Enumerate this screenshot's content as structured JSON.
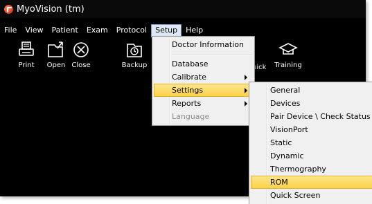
{
  "window": {
    "title": "MyoVision (tm)",
    "app_icon": "myovision-logo-icon"
  },
  "menubar": {
    "items": [
      {
        "label": "File"
      },
      {
        "label": "View"
      },
      {
        "label": "Patient"
      },
      {
        "label": "Exam"
      },
      {
        "label": "Protocol"
      },
      {
        "label": "Setup",
        "active": true
      },
      {
        "label": "Help"
      }
    ]
  },
  "toolbar": {
    "buttons": [
      {
        "label": "Print",
        "icon": "printer-icon"
      },
      {
        "label": "Open",
        "icon": "open-folder-icon"
      },
      {
        "label": "Close",
        "icon": "close-circle-icon"
      },
      {
        "label": "Backup",
        "icon": "backup-clock-icon"
      },
      {
        "label": "uick",
        "icon": ""
      },
      {
        "label": "Training",
        "icon": "graduation-cap-icon"
      }
    ]
  },
  "setup_menu": {
    "items": [
      {
        "label": "Doctor Information"
      },
      {
        "label": "Database"
      },
      {
        "label": "Calibrate",
        "has_submenu": true
      },
      {
        "label": "Settings",
        "has_submenu": true,
        "highlighted": true
      },
      {
        "label": "Reports",
        "has_submenu": true
      },
      {
        "label": "Language",
        "disabled": true
      }
    ]
  },
  "settings_submenu": {
    "items": [
      {
        "label": "General"
      },
      {
        "label": "Devices"
      },
      {
        "label": "Pair Device \\ Check  Status"
      },
      {
        "label": "VisionPort"
      },
      {
        "label": "Static"
      },
      {
        "label": "Dynamic"
      },
      {
        "label": "Thermography"
      },
      {
        "label": "ROM",
        "highlighted": true
      },
      {
        "label": "Quick Screen"
      }
    ]
  },
  "colors": {
    "workspace": "#000000",
    "menu_background": "#f0f0f0",
    "highlight": "#fcd24a"
  }
}
